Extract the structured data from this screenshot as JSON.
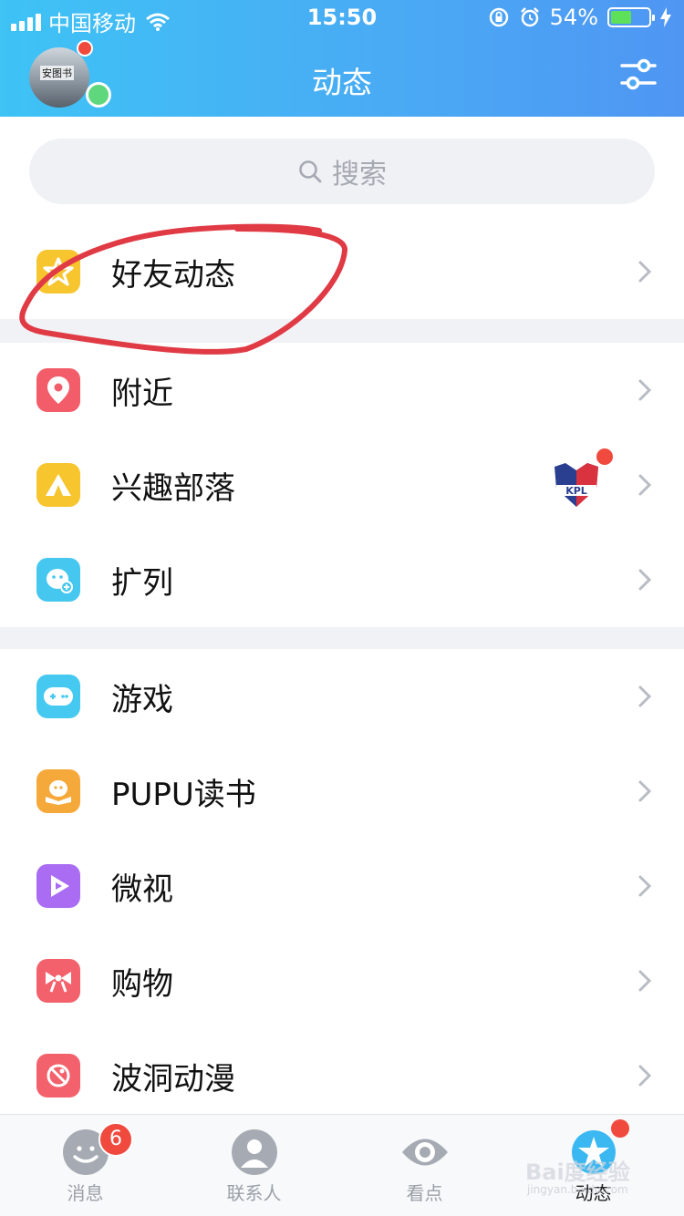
{
  "status_bar": {
    "carrier": "中国移动",
    "time": "15:50",
    "battery": "54%",
    "battery_level": 0.54
  },
  "header": {
    "title": "动态",
    "avatar_text": "安图书"
  },
  "search": {
    "placeholder": "搜索"
  },
  "groups": [
    {
      "items": [
        {
          "label": "好友动态",
          "icon": "star-icon",
          "color": "#f7c52e"
        }
      ]
    },
    {
      "items": [
        {
          "label": "附近",
          "icon": "location-pin-icon",
          "color": "#f25d69"
        },
        {
          "label": "兴趣部落",
          "icon": "tent-icon",
          "color": "#f7c52e",
          "badge_text": "KPL"
        },
        {
          "label": "扩列",
          "icon": "add-friend-face-icon",
          "color": "#45c7ef"
        }
      ]
    },
    {
      "items": [
        {
          "label": "游戏",
          "icon": "gamepad-icon",
          "color": "#46c9f0"
        },
        {
          "label": "PUPU读书",
          "icon": "book-penguin-icon",
          "color": "#f6a93b"
        },
        {
          "label": "微视",
          "icon": "play-icon",
          "color": "#a96cf2"
        },
        {
          "label": "购物",
          "icon": "shopping-bow-icon",
          "color": "#f2616c"
        },
        {
          "label": "波洞动漫",
          "icon": "comic-icon",
          "color": "#f2616c"
        }
      ]
    }
  ],
  "tabbar": {
    "tabs": [
      {
        "label": "消息",
        "icon": "chat-icon",
        "badge": "6"
      },
      {
        "label": "联系人",
        "icon": "contacts-icon"
      },
      {
        "label": "看点",
        "icon": "eye-icon"
      },
      {
        "label": "动态",
        "icon": "star-planet-icon"
      }
    ]
  },
  "watermark": {
    "text": "Bai度经验",
    "sub": "jingyan.baidu.com"
  },
  "colors": {
    "accent": "#4aa9f4",
    "red_dot": "#f0493e",
    "annotation": "#e03a45"
  }
}
